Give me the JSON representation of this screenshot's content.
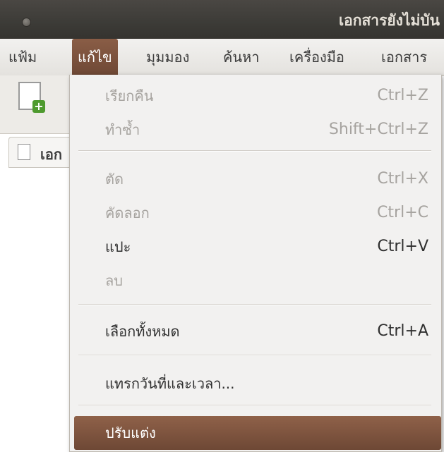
{
  "window": {
    "title": "เอกสารยังไม่บัน"
  },
  "menubar": {
    "items": [
      {
        "label": "แฟ้ม"
      },
      {
        "label": "แก้ไข"
      },
      {
        "label": "มุมมอง"
      },
      {
        "label": "ค้นหา"
      },
      {
        "label": "เครื่องมือ"
      },
      {
        "label": "เอกสาร"
      }
    ],
    "active_index": 1
  },
  "toolbar": {
    "new_document_icon": "new-document-icon"
  },
  "documents": {
    "tab_label": "เอก"
  },
  "edit_menu": {
    "items": [
      {
        "label": "เรียกคืน",
        "accel": "Ctrl+Z",
        "enabled": false
      },
      {
        "label": "ทำซ้ำ",
        "accel": "Shift+Ctrl+Z",
        "enabled": false
      },
      {
        "label": "ตัด",
        "accel": "Ctrl+X",
        "enabled": false
      },
      {
        "label": "คัดลอก",
        "accel": "Ctrl+C",
        "enabled": false
      },
      {
        "label": "แปะ",
        "accel": "Ctrl+V",
        "enabled": true
      },
      {
        "label": "ลบ",
        "accel": "",
        "enabled": false
      },
      {
        "label": "เลือกทั้งหมด",
        "accel": "Ctrl+A",
        "enabled": true
      },
      {
        "label": "แทรกวันที่และเวลา...",
        "accel": "",
        "enabled": true
      },
      {
        "label": "ปรับแต่ง",
        "accel": "",
        "enabled": true,
        "highlighted": true
      }
    ]
  },
  "colors": {
    "accent": "#7a4f3b",
    "titlebar": "#3c3b37",
    "menu_bg": "#f2f1f0",
    "disabled_text": "#a6a39f"
  }
}
